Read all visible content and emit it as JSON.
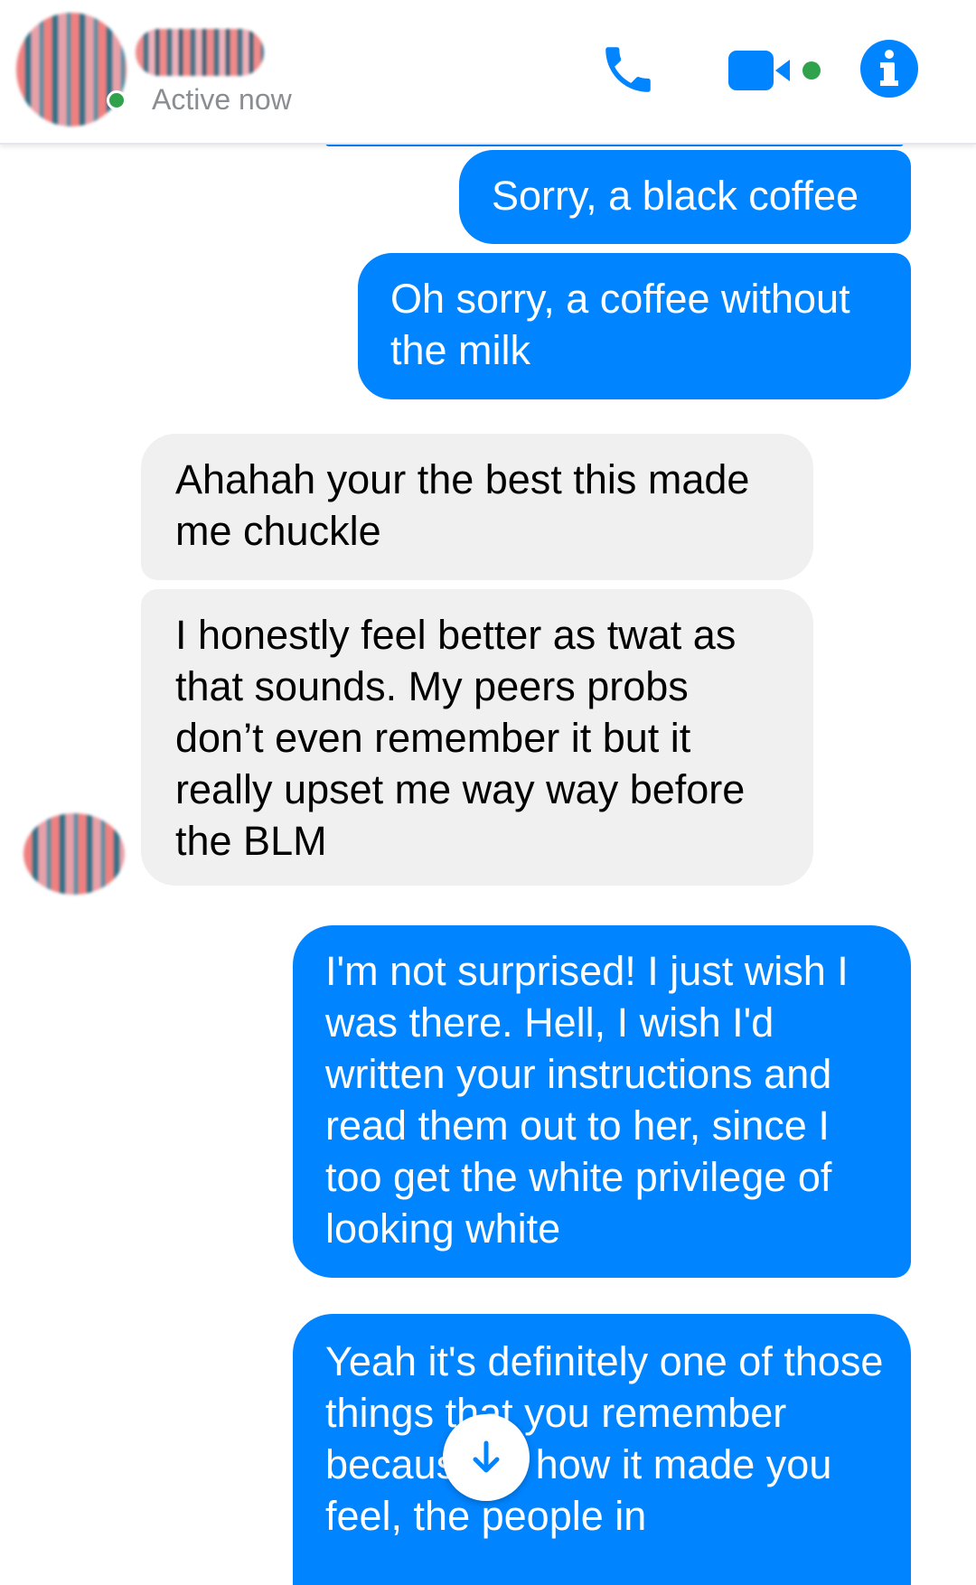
{
  "header": {
    "status": "Active now",
    "icons": [
      "phone-icon",
      "video-camera-icon",
      "info-icon"
    ]
  },
  "colors": {
    "accent": "#0084ff",
    "incoming_bubble": "#f1f0f0",
    "online": "#31a24c"
  },
  "messages": [
    {
      "direction": "outgoing",
      "text": "Sorry, a black coffee"
    },
    {
      "direction": "outgoing",
      "text": "Oh sorry, a coffee without the milk"
    },
    {
      "direction": "incoming",
      "text": "Ahahah your the best this made me chuckle"
    },
    {
      "direction": "incoming",
      "text": "I honestly feel better as twat as that sounds. My peers probs don’t even remember it but it really upset me way way before the BLM"
    },
    {
      "direction": "outgoing",
      "text": "I'm not surprised! I just wish I was there. Hell, I wish I'd written your instructions and read them out to her, since I too get the white privilege of looking white"
    },
    {
      "direction": "outgoing",
      "text": "Yeah it's definitely one of those things that you remember because of how it made you feel, the people in"
    }
  ],
  "scroll_button": {
    "icon": "arrow-down-icon"
  }
}
